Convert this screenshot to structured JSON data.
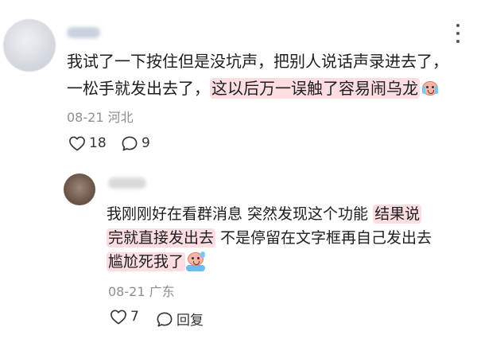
{
  "comment1": {
    "avatar_icon": "user-avatar-icon",
    "text_line1": "我试了一下按住但是没坑声，把别人说话声录进去了，",
    "text_line2_plain": "一松手就发出去了，",
    "text_line2_highlight": "这以后万一误触了容易闹乌龙",
    "emoji_icon": "crying-face-emoji-icon",
    "meta": "08-21 河北",
    "likes": "18",
    "comments": "9"
  },
  "reply1": {
    "avatar_icon": "user-avatar-icon",
    "text_line1_plain": "我刚刚好在看群消息 突然发现这个功能 ",
    "text_line1_highlight": "结果说",
    "text_line2_highlight": "完就直接发出去",
    "text_line2_plain": " 不是停留在文字框再自己发出去",
    "text_line3_highlight": "尴尬死我了",
    "emoji_icon": "sweating-face-emoji-icon",
    "meta": "08-21 广东",
    "likes": "7",
    "reply_label": "回复"
  },
  "icons": {
    "more": "more-vertical-icon",
    "like": "heart-outline-icon",
    "comment": "comment-bubble-icon"
  },
  "colors": {
    "highlight": "#fbdde2",
    "meta_text": "#8a8f98",
    "body_text": "#1e1e1e"
  }
}
